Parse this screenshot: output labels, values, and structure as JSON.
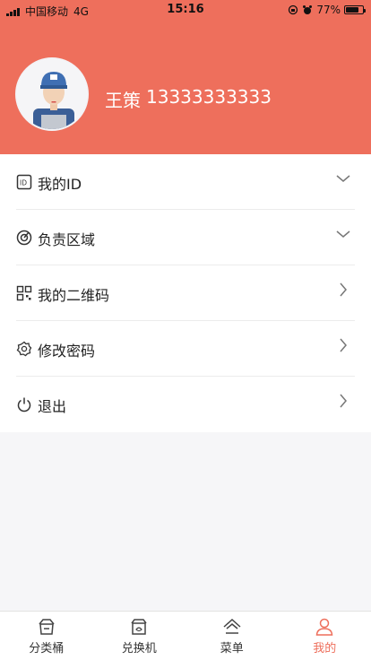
{
  "status": {
    "carrier": "中国移动",
    "network": "4G",
    "time": "15:16",
    "battery": "77%",
    "battery_level": 0.77
  },
  "profile": {
    "name": "王策",
    "phone": "13333333333"
  },
  "menu": [
    {
      "label": "我的ID",
      "icon": "id-card-icon",
      "arrow": "chevron-down-icon"
    },
    {
      "label": "负责区域",
      "icon": "radar-icon",
      "arrow": "chevron-down-icon"
    },
    {
      "label": "我的二维码",
      "icon": "qrcode-icon",
      "arrow": "chevron-right-icon"
    },
    {
      "label": "修改密码",
      "icon": "gear-icon",
      "arrow": "chevron-right-icon"
    },
    {
      "label": "退出",
      "icon": "power-icon",
      "arrow": "chevron-right-icon"
    }
  ],
  "tabs": [
    {
      "label": "分类桶",
      "icon": "bin-icon",
      "active": false
    },
    {
      "label": "兑换机",
      "icon": "machine-icon",
      "active": false
    },
    {
      "label": "菜单",
      "icon": "home-icon",
      "active": false
    },
    {
      "label": "我的",
      "icon": "user-icon",
      "active": true
    }
  ],
  "colors": {
    "accent": "#ee6f5c",
    "background": "#f6f6f8"
  }
}
